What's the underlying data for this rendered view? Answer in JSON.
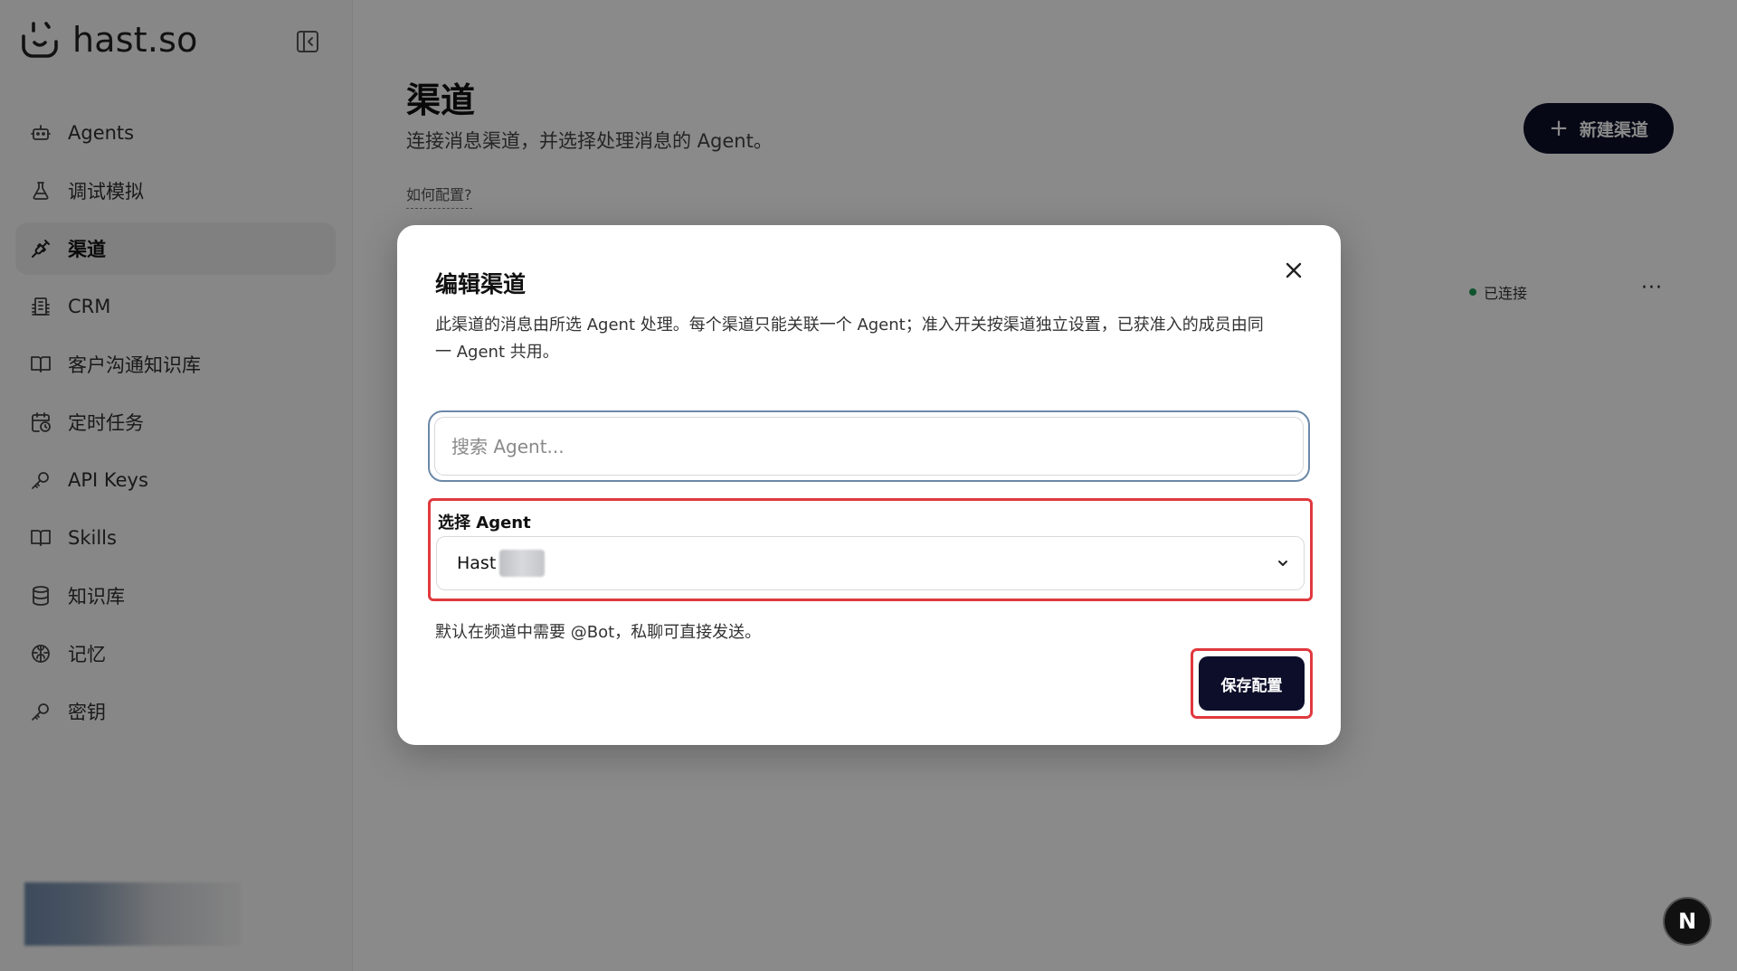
{
  "app": {
    "brand": "hast.so"
  },
  "sidebar": {
    "items": [
      {
        "label": "Agents",
        "icon": "bot-icon"
      },
      {
        "label": "调试模拟",
        "icon": "flask-icon"
      },
      {
        "label": "渠道",
        "icon": "plug-icon",
        "active": true
      },
      {
        "label": "CRM",
        "icon": "building-icon"
      },
      {
        "label": "客户沟通知识库",
        "icon": "book-open-icon"
      },
      {
        "label": "定时任务",
        "icon": "calendar-clock-icon"
      },
      {
        "label": "API Keys",
        "icon": "key-icon"
      },
      {
        "label": "Skills",
        "icon": "book-open-icon"
      },
      {
        "label": "知识库",
        "icon": "database-icon"
      },
      {
        "label": "记忆",
        "icon": "brain-icon"
      },
      {
        "label": "密钥",
        "icon": "key-icon"
      }
    ]
  },
  "main": {
    "title": "渠道",
    "subtitle": "连接消息渠道，并选择处理消息的 Agent。",
    "how_link": "如何配置?",
    "new_button": "新建渠道",
    "row_status": "已连接",
    "row_more": "···"
  },
  "modal": {
    "title": "编辑渠道",
    "description": "此渠道的消息由所选 Agent 处理。每个渠道只能关联一个 Agent；准入开关按渠道独立设置，已获准入的成员由同一 Agent 共用。",
    "search_placeholder": "搜索 Agent...",
    "select_label": "选择 Agent",
    "select_value": "Hast",
    "hint": "默认在频道中需要 @Bot，私聊可直接发送。",
    "save_button": "保存配置"
  },
  "floating_badge": {
    "label": "N"
  },
  "colors": {
    "primary_dark": "#0d0f2a",
    "highlight_red": "#e0393e",
    "focus_ring": "#6b88a8",
    "status_green": "#1f9a58"
  }
}
